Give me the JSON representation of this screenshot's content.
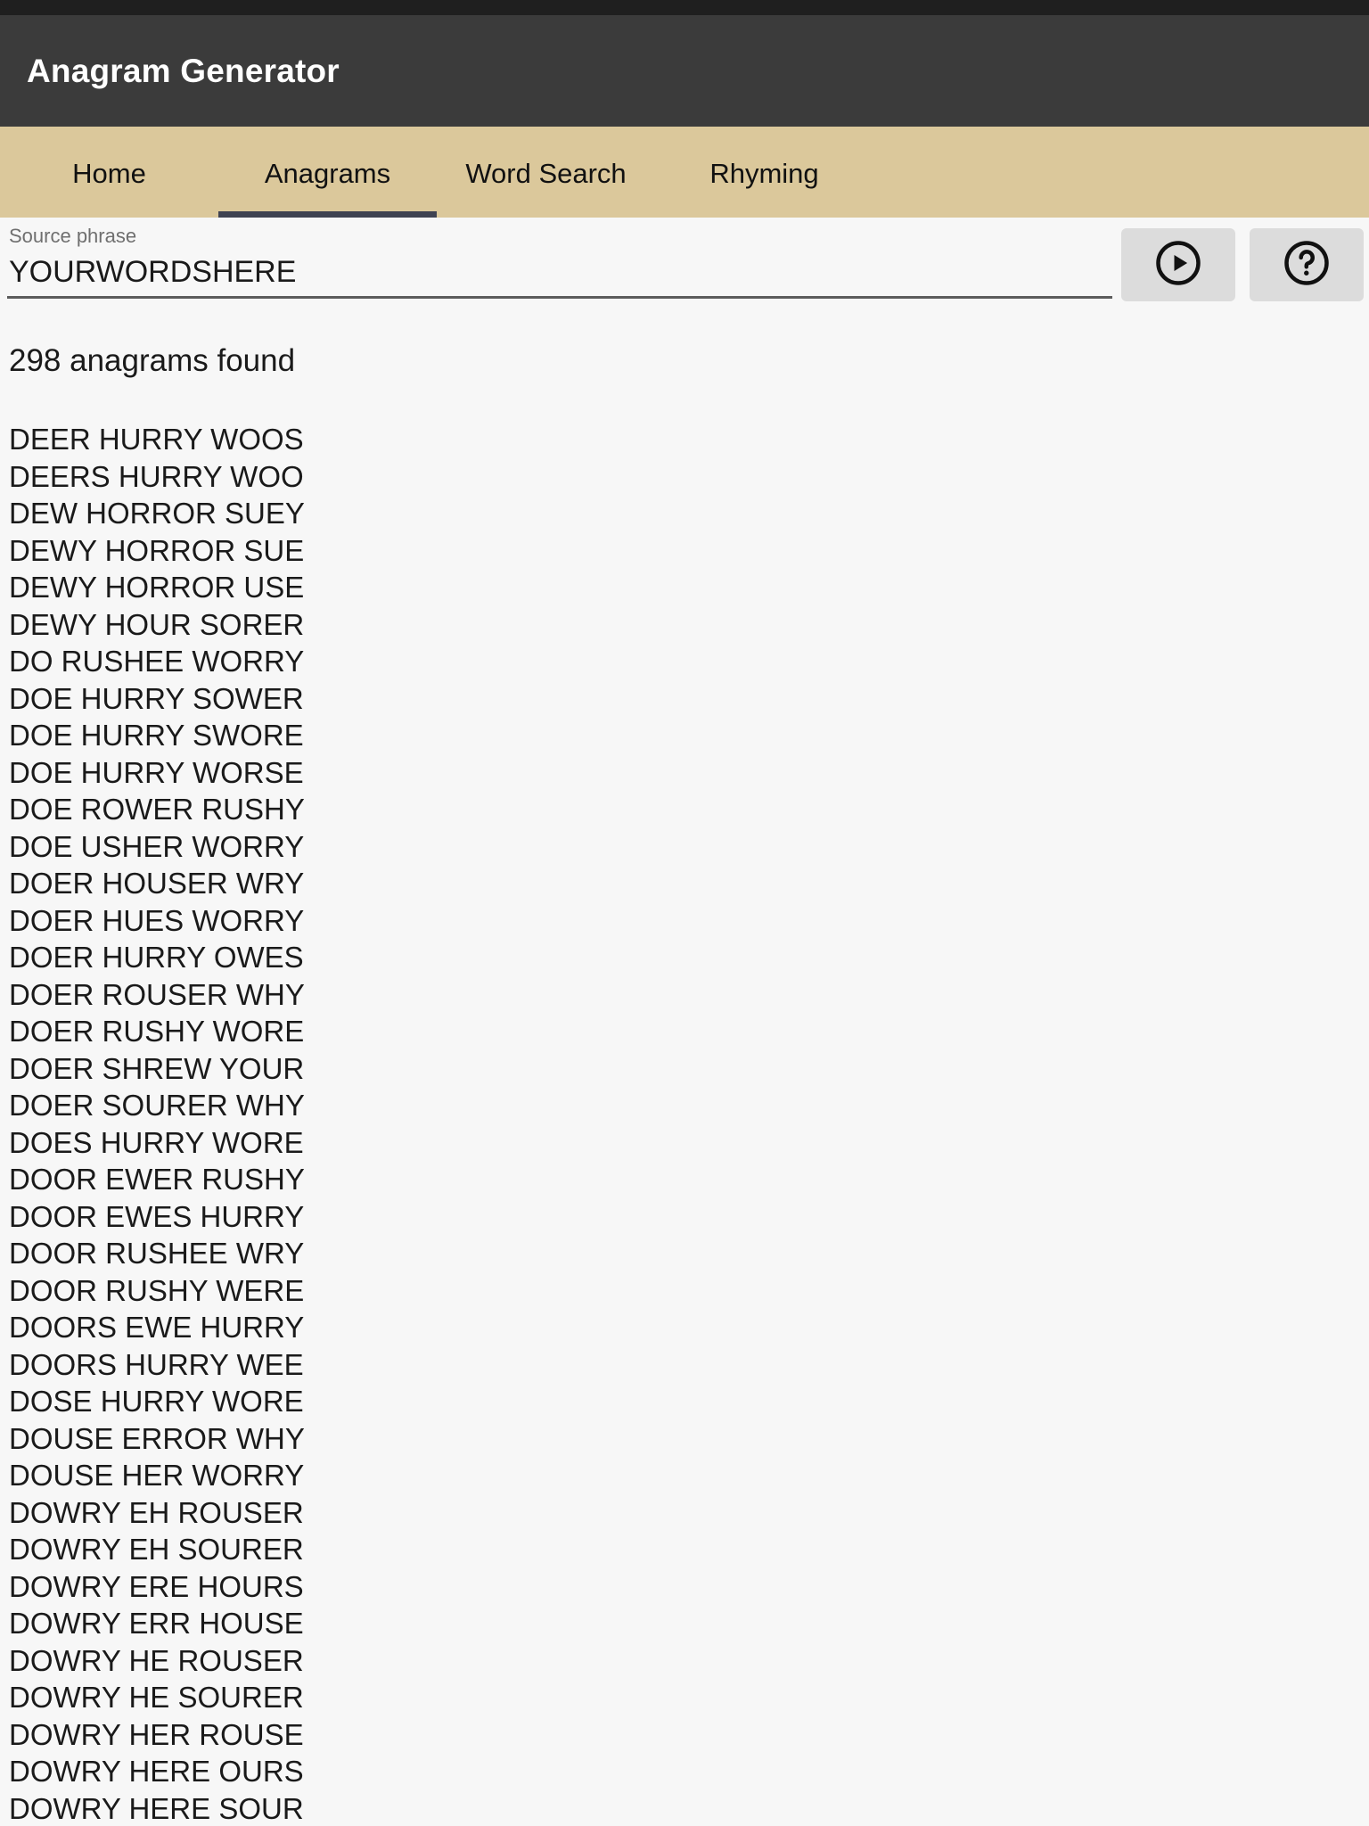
{
  "app": {
    "title": "Anagram Generator"
  },
  "tabs": [
    {
      "label": "Home",
      "name": "tab-home",
      "active": false
    },
    {
      "label": "Anagrams",
      "name": "tab-anagrams",
      "active": true
    },
    {
      "label": "Word Search",
      "name": "tab-word-search",
      "active": false
    },
    {
      "label": "Rhyming",
      "name": "tab-rhyming",
      "active": false
    }
  ],
  "search": {
    "label": "Source phrase",
    "value": "YOURWORDSHERE",
    "placeholder": "Source phrase"
  },
  "actions": {
    "run": {
      "icon": "play-circle-icon"
    },
    "help": {
      "icon": "help-circle-icon"
    }
  },
  "results": {
    "count_text": "298 anagrams found",
    "count": 298,
    "items": [
      "DEER HURRY WOOS",
      "DEERS HURRY WOO",
      "DEW HORROR SUEY",
      "DEWY HORROR SUE",
      "DEWY HORROR USE",
      "DEWY HOUR SORER",
      "DO RUSHEE WORRY",
      "DOE HURRY SOWER",
      "DOE HURRY SWORE",
      "DOE HURRY WORSE",
      "DOE ROWER RUSHY",
      "DOE USHER WORRY",
      "DOER HOUSER WRY",
      "DOER HUES WORRY",
      "DOER HURRY OWES",
      "DOER ROUSER WHY",
      "DOER RUSHY WORE",
      "DOER SHREW YOUR",
      "DOER SOURER WHY",
      "DOES HURRY WORE",
      "DOOR EWER RUSHY",
      "DOOR EWES HURRY",
      "DOOR RUSHEE WRY",
      "DOOR RUSHY WERE",
      "DOORS EWE HURRY",
      "DOORS HURRY WEE",
      "DOSE HURRY WORE",
      "DOUSE ERROR WHY",
      "DOUSE HER WORRY",
      "DOWRY EH ROUSER",
      "DOWRY EH SOURER",
      "DOWRY ERE HOURS",
      "DOWRY ERR HOUSE",
      "DOWRY HE ROUSER",
      "DOWRY HE SOURER",
      "DOWRY HER ROUSE",
      "DOWRY HERE OURS",
      "DOWRY HERE SOUR"
    ]
  },
  "colors": {
    "status_bar": "#1f1f1f",
    "app_bar": "#3b3b3b",
    "tab_bar": "#dbc89b",
    "tab_indicator": "#3f4352",
    "page_background": "#f7f7f7",
    "button_background": "#dcdcdc",
    "text_primary": "#1a1a1a",
    "label_gray": "#6f6f6f"
  }
}
